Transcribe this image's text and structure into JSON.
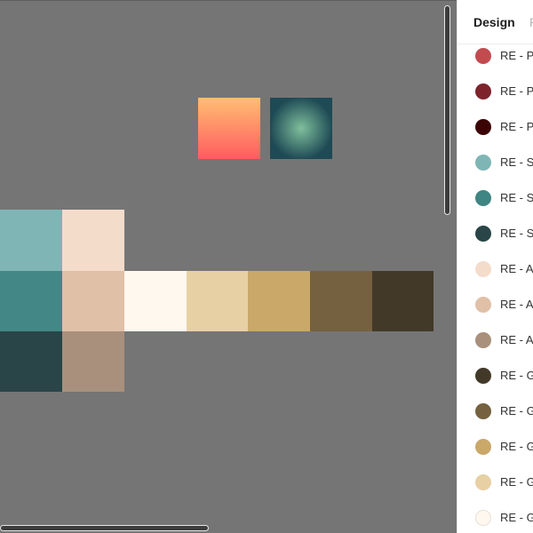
{
  "canvas": {
    "background": "#757575",
    "gradient_swatches": [
      {
        "name": "linear-gradient",
        "from": "#ffbe73",
        "to": "#ff5c60"
      },
      {
        "name": "radial-gradient",
        "center": "#7fbf9c",
        "edge": "#1e4a55"
      }
    ],
    "palette_grid": [
      {
        "color": "#7fb5b5"
      },
      {
        "color": "#f4dccb"
      },
      {
        "color": "#438786"
      },
      {
        "color": "#e0c0a7"
      },
      {
        "color": "#fef8ef"
      },
      {
        "color": "#e8d0a5"
      },
      {
        "color": "#c9a86a"
      },
      {
        "color": "#756140"
      },
      {
        "color": "#423929"
      },
      {
        "color": "#294547"
      },
      {
        "color": "#a8907c"
      }
    ]
  },
  "panel": {
    "tabs": [
      {
        "label": "Design"
      },
      {
        "label": "P"
      }
    ],
    "styles": [
      {
        "label": "RE - P",
        "color": "#c24b50"
      },
      {
        "label": "RE - P",
        "color": "#7e232b"
      },
      {
        "label": "RE - P",
        "color": "#3c0505"
      },
      {
        "label": "RE - S",
        "color": "#7fb5b5"
      },
      {
        "label": "RE - S",
        "color": "#3f8583"
      },
      {
        "label": "RE - S",
        "color": "#294547"
      },
      {
        "label": "RE - A",
        "color": "#f4dccb"
      },
      {
        "label": "RE - A",
        "color": "#e0c0a7"
      },
      {
        "label": "RE - A",
        "color": "#a8907c"
      },
      {
        "label": "RE - G",
        "color": "#423929"
      },
      {
        "label": "RE - G",
        "color": "#756140"
      },
      {
        "label": "RE - G",
        "color": "#c9a86a"
      },
      {
        "label": "RE - G",
        "color": "#e8d0a5"
      },
      {
        "label": "RE - G",
        "color": "#fef8ef"
      }
    ]
  }
}
